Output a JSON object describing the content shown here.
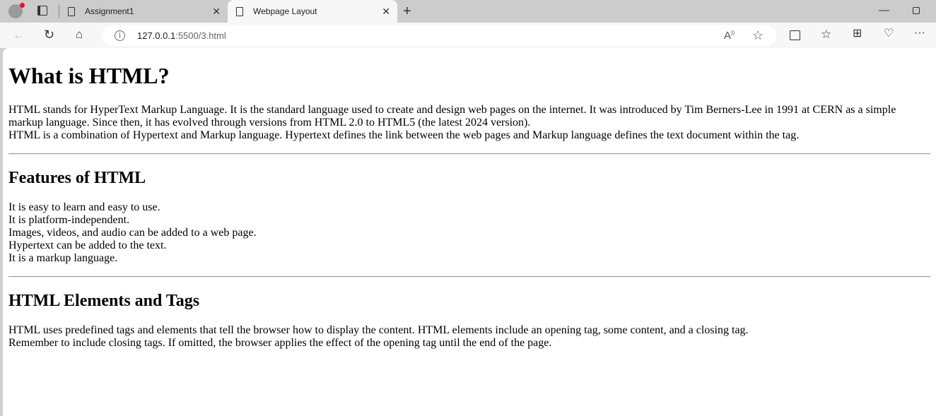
{
  "browser": {
    "tabs": [
      {
        "title": "Assignment1",
        "active": false
      },
      {
        "title": "Webpage Layout",
        "active": true
      }
    ],
    "url_host": "127.0.0.1",
    "url_rest": ":5500/3.html",
    "icons": [
      "profile-icon",
      "tab-actions-icon",
      "back-icon",
      "refresh-icon",
      "home-icon",
      "info-icon",
      "read-aloud-icon",
      "favorite-star-icon",
      "split-screen-icon",
      "favorites-icon",
      "collections-icon",
      "browser-essentials-icon",
      "more-icon",
      "minimize-icon",
      "restore-icon",
      "new-tab-icon"
    ]
  },
  "page": {
    "h1": "What is HTML?",
    "intro": [
      "HTML stands for HyperText Markup Language. It is the standard language used to create and design web pages on the internet. It was introduced by Tim Berners-Lee in 1991 at CERN as a simple markup language. Since then, it has evolved through versions from HTML 2.0 to HTML5 (the latest 2024 version).",
      "HTML is a combination of Hypertext and Markup language. Hypertext defines the link between the web pages and Markup language defines the text document within the tag."
    ],
    "features_title": "Features of HTML",
    "features": [
      "It is easy to learn and easy to use.",
      "It is platform-independent.",
      "Images, videos, and audio can be added to a web page.",
      "Hypertext can be added to the text.",
      "It is a markup language."
    ],
    "elements_title": "HTML Elements and Tags",
    "elements": [
      "HTML uses predefined tags and elements that tell the browser how to display the content. HTML elements include an opening tag, some content, and a closing tag.",
      "Remember to include closing tags. If omitted, the browser applies the effect of the opening tag until the end of the page."
    ]
  }
}
